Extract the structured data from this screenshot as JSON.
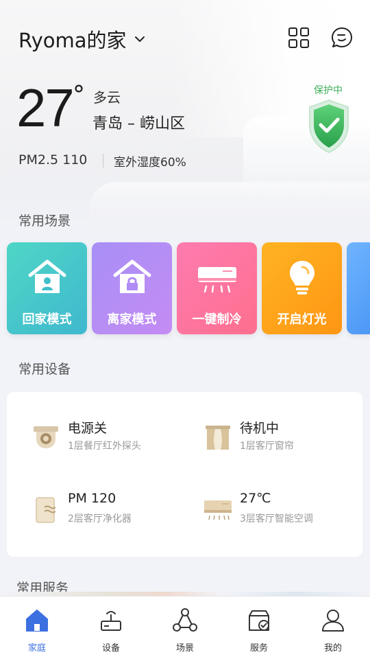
{
  "header": {
    "home_name": "Ryoma的家",
    "icons": [
      "grid-icon",
      "chat-bubble-icon"
    ]
  },
  "weather": {
    "temperature": "27",
    "degree_symbol": "°",
    "condition": "多云",
    "location": "青岛 – 崂山区",
    "pm25": "PM2.5 110",
    "humidity": "室外湿度60%"
  },
  "security": {
    "status": "保护中",
    "icon": "shield-check-icon",
    "color": "#3fae5a"
  },
  "scenes": {
    "title": "常用场景",
    "items": [
      {
        "label": "回家模式",
        "icon": "home-person-icon",
        "color_start": "#4fd6c6",
        "color_end": "#3fb8ce"
      },
      {
        "label": "离家模式",
        "icon": "home-lock-icon",
        "color_start": "#a78ff6",
        "color_end": "#c48cf3"
      },
      {
        "label": "一键制冷",
        "icon": "air-conditioner-icon",
        "color_start": "#ff7bb0",
        "color_end": "#fd6f8e"
      },
      {
        "label": "开启灯光",
        "icon": "light-bulb-icon",
        "color_start": "#ffb323",
        "color_end": "#ff9613"
      },
      {
        "label": "",
        "icon": "",
        "color_start": "#6fb4ff",
        "color_end": "#4d98f6"
      }
    ]
  },
  "devices": {
    "title": "常用设备",
    "items": [
      {
        "title": "电源关",
        "subtitle": "1层餐厅红外探头",
        "icon": "camera-sensor-icon"
      },
      {
        "title": "待机中",
        "subtitle": "1层客厅窗帘",
        "icon": "curtain-icon"
      },
      {
        "title": "PM 120",
        "subtitle": "2层客厅净化器",
        "icon": "air-purifier-icon"
      },
      {
        "title": "27℃",
        "subtitle": "3层客厅智能空调",
        "icon": "air-conditioner-icon"
      }
    ]
  },
  "services": {
    "title": "常用服务"
  },
  "tabbar": {
    "active_color": "#3c6fe0",
    "items": [
      {
        "label": "家庭",
        "icon": "home-icon"
      },
      {
        "label": "设备",
        "icon": "router-icon"
      },
      {
        "label": "场景",
        "icon": "nodes-icon"
      },
      {
        "label": "服务",
        "icon": "service-box-icon"
      },
      {
        "label": "我的",
        "icon": "person-icon"
      }
    ]
  }
}
